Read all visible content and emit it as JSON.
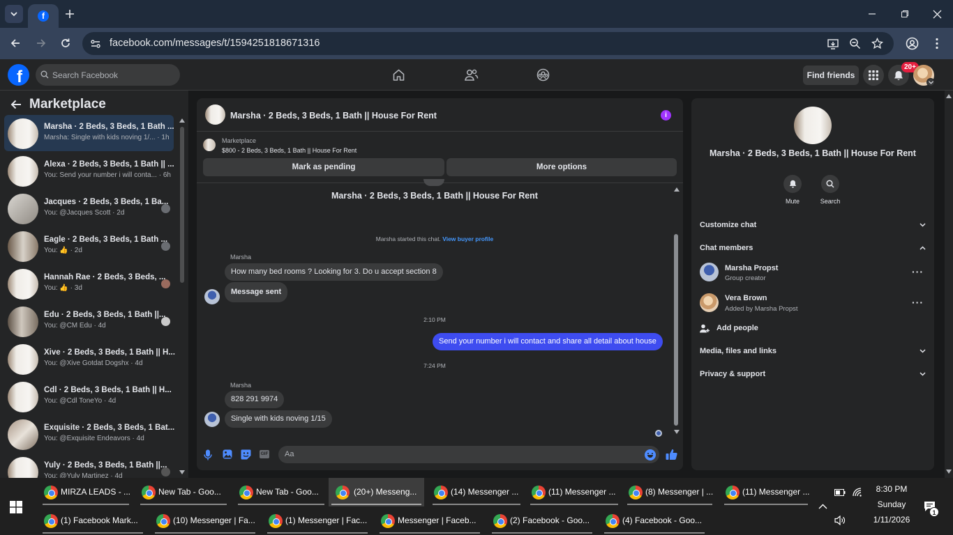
{
  "browser": {
    "url": "facebook.com/messages/t/1594251818671316"
  },
  "fb": {
    "search_placeholder": "Search Facebook",
    "find_friends": "Find friends",
    "notif_badge": "20+"
  },
  "left": {
    "title": "Marketplace",
    "conversations": [
      {
        "title": "Marsha · 2 Beds, 3 Beds, 1 Bath ...",
        "sub": "Marsha: Single with kids noving 1/... · 1h"
      },
      {
        "title": "Alexa · 2 Beds, 3 Beds, 1 Bath || ...",
        "sub": "You: Send your number i will conta... · 6h"
      },
      {
        "title": "Jacques · 2 Beds, 3 Beds, 1 Ba...",
        "sub": "You: @Jacques Scott · 2d"
      },
      {
        "title": "Eagle · 2 Beds, 3 Beds, 1 Bath ...",
        "sub": "You: 👍 · 2d"
      },
      {
        "title": "Hannah Rae · 2 Beds, 3 Beds, ...",
        "sub": "You: 👍 · 3d"
      },
      {
        "title": "Edu · 2 Beds, 3 Beds, 1 Bath ||...",
        "sub": "You: @CM Edu · 4d"
      },
      {
        "title": "Xive · 2 Beds, 3 Beds, 1 Bath || H...",
        "sub": "You: @Xive Gotdat Dogshx · 4d"
      },
      {
        "title": "Cdl · 2 Beds, 3 Beds, 1 Bath || H...",
        "sub": "You: @Cdl ToneYo · 4d"
      },
      {
        "title": "Exquisite · 2 Beds, 3 Beds, 1 Bat...",
        "sub": "You: @Exquisite Endeavors · 4d"
      },
      {
        "title": "Yuly · 2 Beds, 3 Beds, 1 Bath ||...",
        "sub": "You: @Yuly Martinez · 4d"
      }
    ]
  },
  "chat": {
    "title": "Marsha · 2 Beds, 3 Beds, 1 Bath || House For Rent",
    "marketplace_label": "Marketplace",
    "listing": "$800 - 2 Beds, 3 Beds, 1 Bath || House For Rent",
    "mark_pending": "Mark as pending",
    "more_options": "More options",
    "thread_title": "Marsha · 2 Beds, 3 Beds, 1 Bath || House For Rent",
    "started_text": "Marsha started this chat.",
    "view_profile": "View buyer profile",
    "sender1": "Marsha",
    "msg1": "How many bed rooms ? Looking for 3. Do u accept section 8",
    "msg2": "Message sent",
    "time1": "2:10 PM",
    "msg3": "Send your number i will contact and share all detail about house",
    "time2": "7:24 PM",
    "sender2": "Marsha",
    "msg4": "828 291 9974",
    "msg5": "Single with kids noving 1/15",
    "input_placeholder": "Aa",
    "gif_label": "GIF"
  },
  "right": {
    "title": "Marsha · 2 Beds, 3 Beds, 1 Bath || House For Rent",
    "mute": "Mute",
    "search": "Search",
    "customize": "Customize chat",
    "members_heading": "Chat members",
    "members": [
      {
        "name": "Marsha Propst",
        "role": "Group creator"
      },
      {
        "name": "Vera Brown",
        "role": "Added by Marsha Propst"
      }
    ],
    "add_people": "Add people",
    "media": "Media, files and links",
    "privacy": "Privacy & support"
  },
  "taskbar": {
    "row1": [
      "MIRZA LEADS - ...",
      "New Tab - Goo...",
      "New Tab - Goo...",
      "(20+) Messeng...",
      "(14) Messenger ...",
      "(11) Messenger ...",
      "(8) Messenger | ...",
      "(11) Messenger ..."
    ],
    "row2": [
      "(1) Facebook Mark...",
      "(10) Messenger | Fa...",
      "(1) Messenger | Fac...",
      "Messenger | Faceb...",
      "(2) Facebook - Goo...",
      "(4) Facebook - Goo..."
    ],
    "time": "8:30 PM",
    "day": "Sunday",
    "date": "1/11/2026",
    "notif_count": "1"
  },
  "colors": {
    "accent": "#0866ff",
    "outgoing_bubble": "#3e4cf0",
    "info": "#a033ff",
    "badge": "#e41e3f"
  }
}
